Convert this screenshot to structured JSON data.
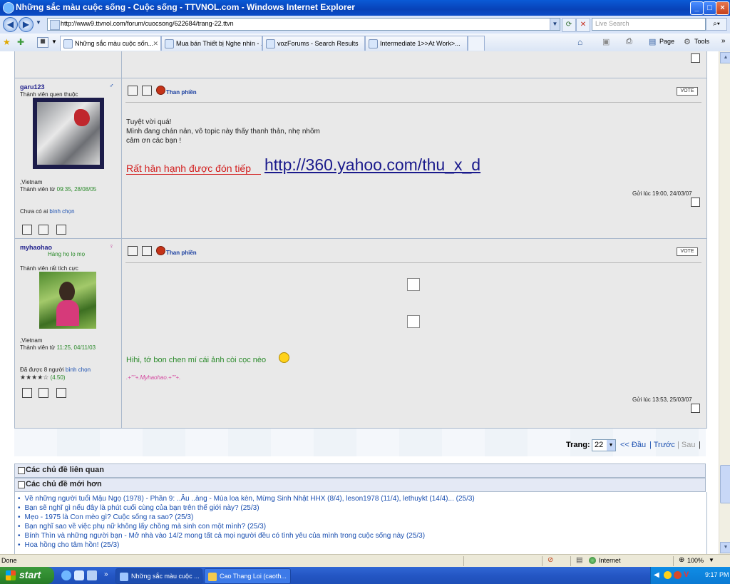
{
  "window": {
    "title": "Những sắc màu cuộc sống - Cuộc sống - TTVNOL.com - Windows Internet Explorer"
  },
  "address": {
    "url": "http://www9.ttvnol.com/forum/cuocsong/622684/trang-22.ttvn"
  },
  "search": {
    "placeholder": "Live Search"
  },
  "tabs": [
    {
      "label": "Những sắc màu cuộc sốn..."
    },
    {
      "label": "Mua bán Thiết bị Nghe nhìn - ..."
    },
    {
      "label": "vozForums - Search Results"
    },
    {
      "label": "Intermediate 1>>At Work>..."
    }
  ],
  "commandbar": {
    "page": "Page",
    "tools": "Tools"
  },
  "posts": [
    {
      "username": "garu123",
      "rank": "Thành viên quen thuộc",
      "location": ",Vietnam",
      "member_since_label": "Thành viên từ",
      "member_since": "09:35, 28/08/05",
      "vote_status_prefix": "Chưa có ai",
      "vote_status_link": "bình chọn",
      "complain": "Than phiền",
      "vote": "VOTE",
      "lines": [
        "Tuyệt vời quá!",
        "Mình đang chán nản, vô topic này thấy thanh thản, nhẹ nhõm",
        "cảm ơn các bạn !"
      ],
      "welcome": "Rất hân hạnh được đón tiếp",
      "link": "http://360.yahoo.com/thu_x_d",
      "posted": "Gửi lúc 19:00, 24/03/07"
    },
    {
      "username": "myhaohao",
      "title": "Hàng họ lọ mọ",
      "rank": "Thành viên rất tích cực",
      "location": ",Vietnam",
      "member_since_label": "Thành viên từ",
      "member_since": "11:25, 04/11/03",
      "vote_status_prefix": "Đã được 8 người",
      "vote_status_link": "bình chọn",
      "stars": "★★★★☆",
      "rating": "(4.50)",
      "complain": "Than phiền",
      "vote": "VOTE",
      "message": "Hihi, tớ bon chen mí cái ảnh còi cọc nèo",
      "signature": ".+\"\"+.Myhaohao.+\"\"+.",
      "posted": "Gửi lúc 13:53, 25/03/07"
    }
  ],
  "pagination": {
    "label": "Trang:",
    "current": "22",
    "first": "<< Đầu",
    "prev": "| Trước",
    "next": "| Sau",
    "end": "|"
  },
  "related": {
    "title": "Các chủ đề liên quan"
  },
  "newer": {
    "title": "Các chủ đề mới hơn",
    "items": [
      "Về những người tuổi Mậu Ngọ (1978) - Phần 9: ..Âu ..àng - Mùa loa kèn, Mừng Sinh Nhật HHX (8/4), leson1978 (11/4), lethuykt (14/4)... (25/3)",
      "Bạn sẽ nghĩ gì nếu đây là phút cuối cùng của bạn trên thế giới này? (25/3)",
      "Mẹo - 1975 là Con mèo gì? Cuộc sống ra sao? (25/3)",
      "Bạn nghĩ sao về việc phụ nữ không lấy chồng mà sinh con một mình? (25/3)",
      "Bính Thìn và những người bạn - Mở nhà vào 14/2 mong tất cả mọi người đều có tình yêu của mình trong cuộc sống này (25/3)",
      "Hoa hồng cho tâm hồn! (25/3)"
    ]
  },
  "status": {
    "left": "Done",
    "zone": "Internet",
    "zoom": "100%"
  },
  "taskbar": {
    "start": "start",
    "tasks": [
      "Những sắc màu cuộc ...",
      "Cao Thang Loi (caoth..."
    ],
    "time": "9:17 PM"
  },
  "colors": {
    "link": "#1a4fb0",
    "green": "#2a8a2a",
    "welcome": "#d21d1d"
  }
}
